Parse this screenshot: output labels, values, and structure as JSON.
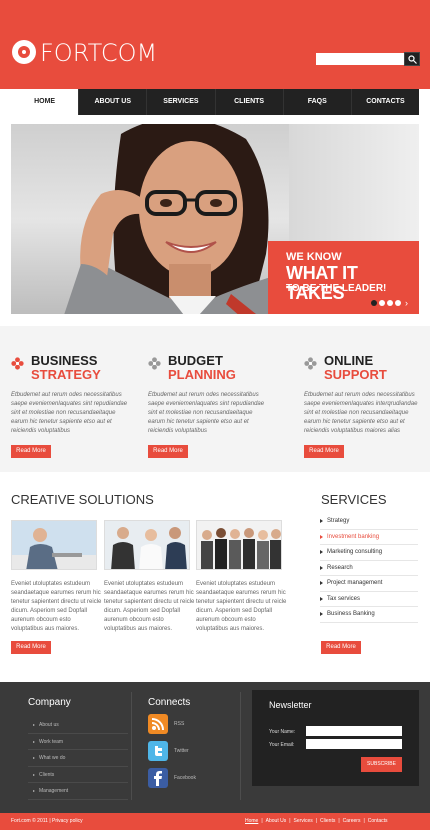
{
  "header": {
    "logo": "FORTCOM",
    "search_placeholder": ""
  },
  "nav": {
    "items": [
      "HOME",
      "ABOUT US",
      "SERVICES",
      "CLIENTS",
      "FAQS",
      "CONTACTS"
    ],
    "active_index": 0
  },
  "hero": {
    "line1": "WE KNOW",
    "line2": "WHAT IT TAKES",
    "line3": "TO BE THE LEADER!",
    "slides": 4,
    "active_slide": 1
  },
  "features": [
    {
      "title1": "BUSINESS",
      "title2": "STRATEGY",
      "text": "Etbudemet aut rerum odes necessitatibus saepe eveniemenlaquates sint repudiandae sint et molestiae non recusandaeitaque earum hic tenetur sapiente etso aut et reiciendis voluptatibus",
      "button": "Read More"
    },
    {
      "title1": "BUDGET",
      "title2": "PLANNING",
      "text": "Etbudemet aut rerum odes necessitatibus saepe eveniemenlaquates sint repudiandae sint et molestiae non recusandaeitaque earum hic tenetur sapiente etso aut et reiciendis voluptatibus",
      "button": "Read More"
    },
    {
      "title1": "ONLINE",
      "title2": "SUPPORT",
      "text": "Etbudemet aut rerum odes necessitatibus saepe eveniemenlaquates interqrudiandae sint et molestiae non recusandaeitaque earum hic tenetur sapiente etso aut et reiciendis voluptatibus maiores alias",
      "button": "Read More"
    }
  ],
  "creative": {
    "title": "CREATIVE SOLUTIONS",
    "items": [
      {
        "text": "Eveniet utoluptates estudeum seandaetaque earumes rerum hic tenetur sapientent directu ut reicle dicum. Asperiom sed Dopfall aurenum obcoum esto voluptatibus aus maiores."
      },
      {
        "text": "Eveniet utoluptates estudeum seandaetaque earumes rerum hic tenetur sapientent directu ut reicle dicum. Asperiom sed Dopfall aurenum obcoum esto voluptatibus aus maiores."
      },
      {
        "text": "Eveniet utoluptates estudeum seandaetaque earumes rerum hic tenetur sapientent directu ut reicle dicum. Asperiom sed Dopfall aurenum obcoum esto voluptatibus aus maiores."
      }
    ],
    "button": "Read More"
  },
  "services": {
    "title": "SERVICES",
    "items": [
      "Strategy",
      "Investment banking",
      "Marketing consulting",
      "Research",
      "Project management",
      "Tax services",
      "Business Banking"
    ],
    "active_index": 1,
    "button": "Read More"
  },
  "footer": {
    "company_title": "Company",
    "company_links": [
      "About us",
      "Work team",
      "What we do",
      "Clients",
      "Management"
    ],
    "connects_title": "Connects",
    "connects": [
      {
        "label": "RSS",
        "icon": "rss-icon",
        "color": "#f08a24"
      },
      {
        "label": "Twitter",
        "icon": "twitter-icon",
        "color": "#4fb6e8"
      },
      {
        "label": "Facebook",
        "icon": "facebook-icon",
        "color": "#3b5da3"
      }
    ],
    "newsletter_title": "Newsletter",
    "name_label": "Your Name:",
    "email_label": "Your Email:",
    "subscribe": "SUBSCRIBE"
  },
  "bottom": {
    "copyright": "Fort.com © 2011 | Privacy policy",
    "links": [
      "Home",
      "About Us",
      "Services",
      "Clients",
      "Careers",
      "Contacts"
    ]
  },
  "colors": {
    "accent": "#e84c3d",
    "dark": "#222222",
    "footer": "#3a3a3a"
  }
}
